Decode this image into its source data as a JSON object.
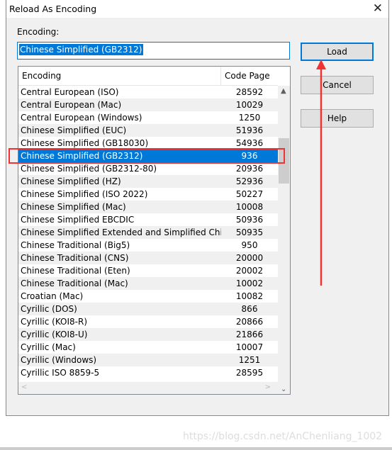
{
  "dialog": {
    "title": "Reload As Encoding",
    "encoding_label": "Encoding:",
    "encoding_value": "Chinese Simplified (GB2312)"
  },
  "buttons": {
    "load": "Load",
    "cancel": "Cancel",
    "help": "Help"
  },
  "list": {
    "headers": [
      "Encoding",
      "Code Page"
    ],
    "rows": [
      [
        "Central European (ISO)",
        "28592"
      ],
      [
        "Central European (Mac)",
        "10029"
      ],
      [
        "Central European (Windows)",
        "1250"
      ],
      [
        "Chinese Simplified (EUC)",
        "51936"
      ],
      [
        "Chinese Simplified (GB18030)",
        "54936"
      ],
      [
        "Chinese Simplified (GB2312)",
        "936"
      ],
      [
        "Chinese Simplified (GB2312-80)",
        "20936"
      ],
      [
        "Chinese Simplified (HZ)",
        "52936"
      ],
      [
        "Chinese Simplified (ISO 2022)",
        "50227"
      ],
      [
        "Chinese Simplified (Mac)",
        "10008"
      ],
      [
        "Chinese Simplified EBCDIC",
        "50936"
      ],
      [
        "Chinese Simplified Extended and Simplified Chinese",
        "50935"
      ],
      [
        "Chinese Traditional (Big5)",
        "950"
      ],
      [
        "Chinese Traditional (CNS)",
        "20000"
      ],
      [
        "Chinese Traditional (Eten)",
        "20002"
      ],
      [
        "Chinese Traditional (Mac)",
        "10002"
      ],
      [
        "Croatian (Mac)",
        "10082"
      ],
      [
        "Cyrillic (DOS)",
        "866"
      ],
      [
        "Cyrillic (KOI8-R)",
        "20866"
      ],
      [
        "Cyrillic (KOI8-U)",
        "21866"
      ],
      [
        "Cyrillic (Mac)",
        "10007"
      ],
      [
        "Cyrillic (Windows)",
        "1251"
      ],
      [
        "Cyrillic ISO 8859-5",
        "28595"
      ]
    ],
    "selected_index": 5
  },
  "watermark": "https://blog.csdn.net/AnChenliang_1002",
  "colors": {
    "selection": "#0078d7",
    "annotation": "#e33333"
  }
}
